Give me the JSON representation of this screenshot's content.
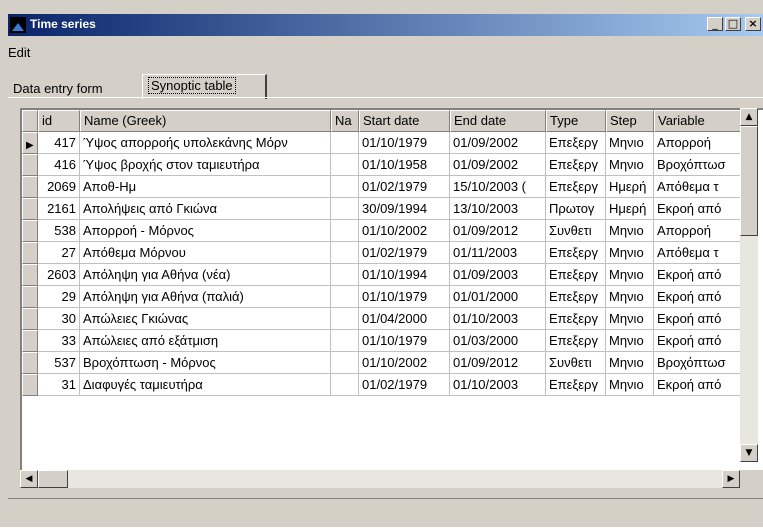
{
  "window": {
    "title": "Time series"
  },
  "menu": {
    "edit": "Edit"
  },
  "tabs": [
    {
      "label": "Data entry form"
    },
    {
      "label": "Synoptic table"
    }
  ],
  "table": {
    "headers": [
      "",
      "id",
      "Name (Greek)",
      "Na",
      "Start date",
      "End date",
      "Type",
      "Step",
      "Variable"
    ],
    "rows": [
      [
        "417",
        "Ύψος απορροής υπολεκάνης Μόρν",
        "",
        "01/10/1979",
        "01/09/2002",
        "Επεξεργ",
        "Μηνιο",
        "Απορροή"
      ],
      [
        "416",
        "Ύψος βροχής στον ταμιευτήρα",
        "",
        "01/10/1958",
        "01/09/2002",
        "Επεξεργ",
        "Μηνιο",
        "Βροχόπτωσ"
      ],
      [
        "2069",
        "Αποθ-Ημ",
        "",
        "01/02/1979",
        "15/10/2003 (",
        "Επεξεργ",
        "Ημερή",
        "Απόθεμα τ"
      ],
      [
        "2161",
        "Απολήψεις από Γκιώνα",
        "",
        "30/09/1994",
        "13/10/2003",
        "Πρωτογ",
        "Ημερή",
        "Εκροή από"
      ],
      [
        "538",
        "Απορροή - Μόρνος",
        "",
        "01/10/2002",
        "01/09/2012",
        "Συνθετι",
        "Μηνιο",
        "Απορροή"
      ],
      [
        "27",
        "Απόθεμα Μόρνου",
        "",
        "01/02/1979",
        "01/11/2003",
        "Επεξεργ",
        "Μηνιο",
        "Απόθεμα τ"
      ],
      [
        "2603",
        "Απόληψη για Αθήνα (νέα)",
        "",
        "01/10/1994",
        "01/09/2003",
        "Επεξεργ",
        "Μηνιο",
        "Εκροή από"
      ],
      [
        "29",
        "Απόληψη για Αθήνα (παλιά)",
        "",
        "01/10/1979",
        "01/01/2000",
        "Επεξεργ",
        "Μηνιο",
        "Εκροή από"
      ],
      [
        "30",
        "Απώλειες Γκιώνας",
        "",
        "01/04/2000",
        "01/10/2003",
        "Επεξεργ",
        "Μηνιο",
        "Εκροή από"
      ],
      [
        "33",
        "Απώλειες από εξάτμιση",
        "",
        "01/10/1979",
        "01/03/2000",
        "Επεξεργ",
        "Μηνιο",
        "Εκροή από"
      ],
      [
        "537",
        "Βροχόπτωση - Μόρνος",
        "",
        "01/10/2002",
        "01/09/2012",
        "Συνθετι",
        "Μηνιο",
        "Βροχόπτωσ"
      ],
      [
        "31",
        "Διαφυγές ταμιευτήρα",
        "",
        "01/02/1979",
        "01/10/2003",
        "Επεξεργ",
        "Μηνιο",
        "Εκροή από"
      ]
    ]
  },
  "icons": {
    "minimize": "minimize-icon",
    "maximize": "maximize-icon",
    "close": "close-icon"
  },
  "colors": {
    "titlebar_start": "#0a246a",
    "titlebar_end": "#a6caf0",
    "face": "#d4d0c8"
  }
}
